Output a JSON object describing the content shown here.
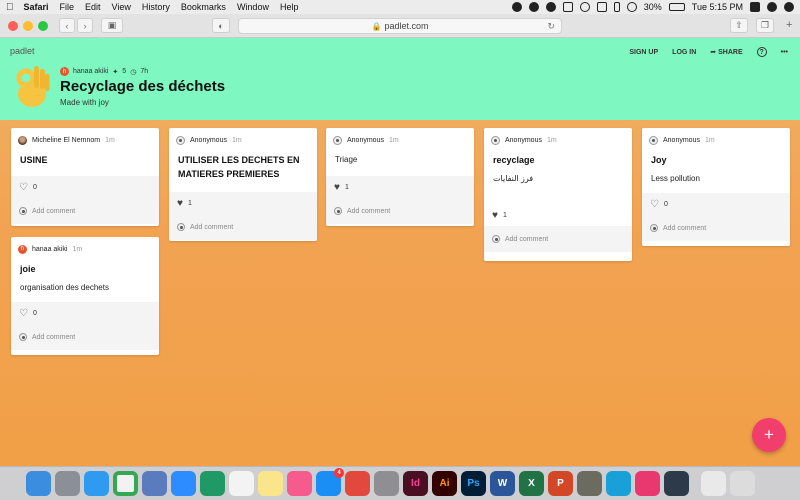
{
  "menubar": {
    "app": "Safari",
    "items": [
      "File",
      "Edit",
      "View",
      "History",
      "Bookmarks",
      "Window",
      "Help"
    ],
    "battery": "30%",
    "clock": "Tue 5:15 PM"
  },
  "browser": {
    "url": "padlet.com"
  },
  "padlet": {
    "brand": "padlet",
    "nav": {
      "signup": "SIGN UP",
      "login": "LOG IN",
      "share": "SHARE",
      "help": "?",
      "more": "•••"
    },
    "owner": "hanaa akiki",
    "owner_initial": "h",
    "karma": "5",
    "age": "7h",
    "title": "Recyclage des déchets",
    "subtitle": "Made with joy"
  },
  "cards": [
    {
      "author": "Micheline El Nemnom",
      "time": "1m",
      "title": "USINE",
      "body": "",
      "likes": "0",
      "add_comment": "Add comment"
    },
    {
      "author": "hanaa akiki",
      "author_initial": "h",
      "time": "1m",
      "title": "joie",
      "body": "organisation des dechets",
      "likes": "0",
      "add_comment": "Add comment"
    },
    {
      "author": "Anonymous",
      "time": "1m",
      "title": "UTILISER LES DECHETS EN MATIERES PREMIERES",
      "body": "",
      "likes": "1",
      "add_comment": "Add comment"
    },
    {
      "author": "Anonymous",
      "time": "1m",
      "title": "",
      "body": "Triage",
      "likes": "1",
      "add_comment": "Add comment"
    },
    {
      "author": "Anonymous",
      "time": "1m",
      "title": "recyclage",
      "body": "فرز النفايات",
      "likes": "1",
      "add_comment": "Add comment"
    },
    {
      "author": "Anonymous",
      "time": "1m",
      "title": "Joy",
      "body": "Less pollution",
      "likes": "0",
      "add_comment": "Add comment"
    }
  ],
  "fab": "+",
  "dock": {
    "indesign": "Id",
    "illustrator": "Ai",
    "photoshop": "Ps",
    "word": "W",
    "excel": "X",
    "powerpoint": "P",
    "appstore_badge": "4"
  },
  "colors": {
    "header": "#7ef7c0",
    "background": "#f2a352",
    "fab": "#f23e6d"
  }
}
